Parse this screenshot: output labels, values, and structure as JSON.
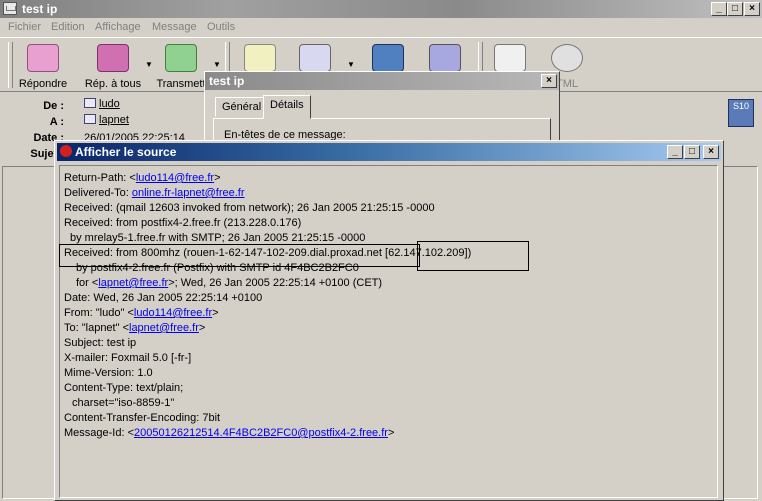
{
  "window": {
    "title": "test ip",
    "min": "_",
    "max": "□",
    "close": "×"
  },
  "menu": [
    "Fichier",
    "Edition",
    "Affichage",
    "Message",
    "Outils"
  ],
  "toolbar": {
    "reply": "Répondre",
    "reply_all": "Rép. à tous",
    "forward": "Transmett",
    "html": "TML"
  },
  "header": {
    "de_label": "De :",
    "de_value": "ludo",
    "a_label": "A :",
    "a_value": "lapnet",
    "date_label": "Date :",
    "date_value": "26/01/2005 22:25:14",
    "sujet_label": "Sujet :"
  },
  "dialog_test": {
    "title": "test ip",
    "tab_general": "Général",
    "tab_details": "Détails",
    "content": "En-têtes de ce message:"
  },
  "source": {
    "title": "Afficher le source",
    "lines": {
      "l1_pre": "Return-Path: <",
      "l1_link": "ludo114@free.fr",
      "l1_post": ">",
      "l2_pre": "Delivered-To: ",
      "l2_link": "online.fr-lapnet@free.fr",
      "l3": "Received: (qmail 12603 invoked from network); 26 Jan 2005 21:25:15 -0000",
      "l4": "Received: from postfix4-2.free.fr (213.228.0.176)",
      "l5": "  by mrelay5-1.free.fr with SMTP; 26 Jan 2005 21:25:15 -0000",
      "l6_pre": "Received: from 800mhz (rouen-1-62-147-102-209.dial.proxad.net ",
      "l6_ip": "[62.147.102.209])",
      "l7": "by postfix4-2.free.fr (Postfix) with SMTP id 4F4BC2B2FC0",
      "l8_pre": "for <",
      "l8_link": "lapnet@free.fr",
      "l8_post": ">; Wed, 26 Jan 2005 22:25:14 +0100 (CET)",
      "l9": "Date: Wed, 26 Jan 2005 22:25:14 +0100",
      "l10_pre": "From: \"ludo\" <",
      "l10_link": "ludo114@free.fr",
      "l10_post": ">",
      "l11_pre": "To: \"lapnet\" <",
      "l11_link": "lapnet@free.fr",
      "l11_post": ">",
      "l12": "Subject: test ip",
      "l13": "X-mailer: Foxmail 5.0 [-fr-]",
      "l14": "Mime-Version: 1.0",
      "l15": "Content-Type: text/plain;",
      "l16": "charset=\"iso-8859-1\"",
      "l17": "Content-Transfer-Encoding: 7bit",
      "l18_pre": "Message-Id: <",
      "l18_link": "20050126212514.4F4BC2B2FC0@postfix4-2.free.fr",
      "l18_post": ">"
    }
  }
}
